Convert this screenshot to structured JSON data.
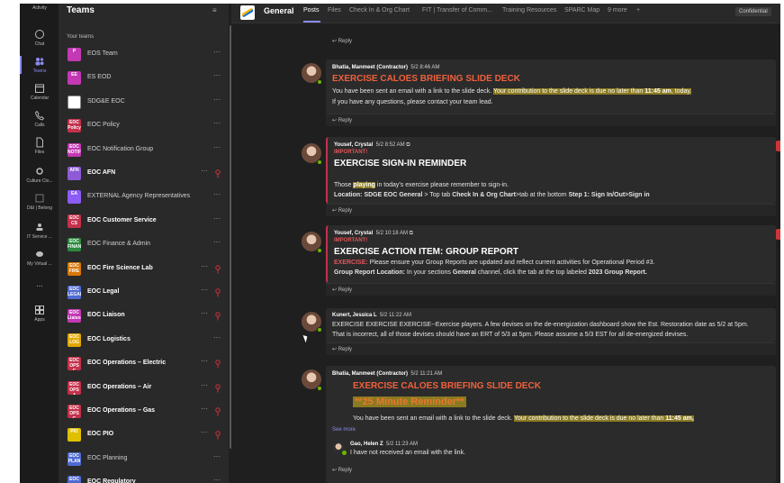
{
  "rail": {
    "items": [
      {
        "label": "Activity",
        "icon": "bell-icon"
      },
      {
        "label": "Chat",
        "icon": "chat-icon"
      },
      {
        "label": "Teams",
        "icon": "teams-icon",
        "active": true
      },
      {
        "label": "Calendar",
        "icon": "calendar-icon"
      },
      {
        "label": "Calls",
        "icon": "phone-icon"
      },
      {
        "label": "Files",
        "icon": "file-icon"
      },
      {
        "label": "Culture Clo...",
        "icon": "culture-icon"
      },
      {
        "label": "D&I | Belong",
        "icon": "belong-icon"
      },
      {
        "label": "IT Service ...",
        "icon": "service-icon"
      },
      {
        "label": "My Virtual ...",
        "icon": "virtual-icon"
      },
      {
        "label": "...",
        "icon": "more-icon"
      },
      {
        "label": "Apps",
        "icon": "apps-icon"
      }
    ]
  },
  "teams_panel": {
    "title": "Teams",
    "section": "Your teams",
    "teams": [
      {
        "name": "EOS Team",
        "avatar": "P",
        "color": "#c239b3",
        "bold": false,
        "alert": false
      },
      {
        "name": "ES EOD",
        "avatar": "EE",
        "color": "#c239b3",
        "bold": false,
        "alert": false
      },
      {
        "name": "SDG&E EOC",
        "avatar": "",
        "color": "#ffffff",
        "bold": false,
        "alert": false
      },
      {
        "name": "EOC Policy",
        "avatar": "EOC Policy",
        "color": "#c4314b",
        "bold": false,
        "alert": false
      },
      {
        "name": "EOC Notification Group",
        "avatar": "EOC NOTIFY",
        "color": "#c239b3",
        "bold": false,
        "alert": false
      },
      {
        "name": "EOC AFN",
        "avatar": "AFN",
        "color": "#8e5bd6",
        "bold": true,
        "alert": true
      },
      {
        "name": "EXTERNAL Agency Representatives",
        "avatar": "EA",
        "color": "#8b5cf6",
        "bold": false,
        "alert": false
      },
      {
        "name": "EOC Customer Service",
        "avatar": "EOC CS",
        "color": "#c4314b",
        "bold": true,
        "alert": false
      },
      {
        "name": "EOC Finance & Admin",
        "avatar": "EOC FINAN",
        "color": "#2b8a3e",
        "bold": false,
        "alert": false
      },
      {
        "name": "EOC Fire Science Lab",
        "avatar": "EOC FIRE",
        "color": "#d97706",
        "bold": true,
        "alert": true
      },
      {
        "name": "EOC Legal",
        "avatar": "EOC LEGAL",
        "color": "#4f6bd1",
        "bold": true,
        "alert": true
      },
      {
        "name": "EOC Liaison",
        "avatar": "EOC Liaison",
        "color": "#c239b3",
        "bold": true,
        "alert": true
      },
      {
        "name": "EOC Logistics",
        "avatar": "EOC LOG",
        "color": "#e0a800",
        "bold": true,
        "alert": false
      },
      {
        "name": "EOC Operations – Electric",
        "avatar": "EOC OPS E",
        "color": "#c4314b",
        "bold": true,
        "alert": true
      },
      {
        "name": "EOC Operations – Air",
        "avatar": "EOC OPS A",
        "color": "#c4314b",
        "bold": true,
        "alert": true
      },
      {
        "name": "EOC Operations – Gas",
        "avatar": "EOC OPS G",
        "color": "#c4314b",
        "bold": true,
        "alert": true
      },
      {
        "name": "EOC PIO",
        "avatar": "PIO",
        "color": "#e0c000",
        "bold": true,
        "alert": true
      },
      {
        "name": "EOC Planning",
        "avatar": "EOC PLAN",
        "color": "#4f6bd1",
        "bold": false,
        "alert": false
      },
      {
        "name": "EOC Regulatory",
        "avatar": "EOC",
        "color": "#4f6bd1",
        "bold": true,
        "alert": false
      }
    ]
  },
  "channel": {
    "name": "General",
    "tabs": [
      "Posts",
      "Files",
      "Check In & Org Chart",
      "FIT | Transfer of Comm...",
      "Training Resources",
      "SPARC Map",
      "9 more"
    ],
    "add_tab": "+",
    "label": "Confidential",
    "reply_label": "Reply",
    "see_more": "See more"
  },
  "posts": [
    {
      "author": "Bhatia, Manmeet (Contractor)",
      "time": "5/2 8:46 AM",
      "subject": "EXERCISE CALOES BRIEFING SLIDE DECK",
      "line1a": "You have been sent an email with a link to the slide deck.",
      "line1b": "Your contribution to the slide deck is due no later than",
      "line1c": "11:45 am",
      "line1d": ", today.",
      "line2": "If you have any questions, please contact your team lead."
    },
    {
      "author": "Yousef, Crystal",
      "time": "5/2 8:52 AM",
      "important": "IMPORTANT!",
      "subject": "EXERCISE SIGN-IN REMINDER",
      "line1a": "Those",
      "line1b": "playing",
      "line1c": "in today's exercise please remember to sign-in.",
      "line2a": "Location: SDGE EOC General",
      "line2b": " > Top tab ",
      "line2c": "Check In & Org Chart",
      "line2d": ">tab at the bottom ",
      "line2e": "Step 1: Sign In/Out>Sign in"
    },
    {
      "author": "Yousef, Crystal",
      "time": "5/2 10:18 AM",
      "important": "IMPORTANT!",
      "subject": "EXERCISE ACTION ITEM: GROUP REPORT",
      "line1a": "EXERCISE:",
      "line1b": " Please ensure your Group Reports are updated and reflect current activities for Operational Period #3.",
      "line2a": "Group Report Location:",
      "line2b": " In your sections ",
      "line2c": "General",
      "line2d": " channel, click the tab at the top labeled ",
      "line2e": "2023 Group Report."
    },
    {
      "author": "Kunert, Jessica L",
      "time": "5/2 11:22 AM",
      "line1": "EXERCISE EXERCISE EXERCISE--Exercise players. A few devises on the de-energization dashboard show the Est. Restoration date as 5/2 at 5pm.",
      "line2": "That is incorrect, all of those devises should have an ERT of 5/3 at 5pm. Please assume a 5/3 EST for all de-energized devises."
    },
    {
      "author": "Bhatia, Manmeet (Contractor)",
      "time": "5/2 11:21 AM",
      "subject": "EXERCISE CALOES BRIEFING SLIDE DECK",
      "reminder": "**25 Minute Reminder**",
      "line1a": "You have been sent an email with a link to the slide deck.",
      "line1b": "Your contribution to the slide deck is due no later than",
      "line1c": "11:45 am,",
      "reply_author": "Gao, Helen Z",
      "reply_time": "5/2 11:23 AM",
      "reply_text": "I have not received an email with the link."
    }
  ]
}
